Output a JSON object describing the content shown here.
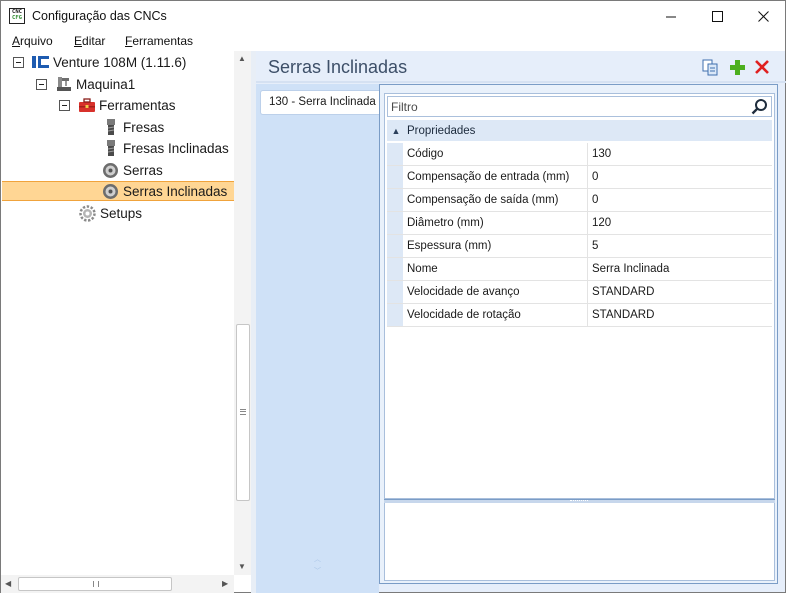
{
  "window": {
    "title": "Configuração das CNCs",
    "app_icon_text_top": "CNC",
    "app_icon_text_bottom": "CFG"
  },
  "menu": [
    {
      "underline": "A",
      "rest": "rquivo"
    },
    {
      "underline": "E",
      "rest": "ditar"
    },
    {
      "underline": "F",
      "rest": "erramentas"
    }
  ],
  "tree": {
    "root": "Venture 108M (1.11.6)",
    "machine": "Maquina1",
    "tools": "Ferramentas",
    "fresas": "Fresas",
    "fresas_inclinadas": "Fresas Inclinadas",
    "serras": "Serras",
    "serras_inclinadas": "Serras Inclinadas",
    "setups": "Setups"
  },
  "right": {
    "section_title": "Serras Inclinadas",
    "list_items": [
      "130 - Serra Inclinada"
    ]
  },
  "filter": {
    "placeholder": "Filtro"
  },
  "properties": {
    "category": "Propriedades",
    "rows": [
      {
        "name": "Código",
        "value": "130"
      },
      {
        "name": "Compensação de entrada (mm)",
        "value": "0"
      },
      {
        "name": "Compensação de saída (mm)",
        "value": "0"
      },
      {
        "name": "Diâmetro (mm)",
        "value": "120"
      },
      {
        "name": "Espessura (mm)",
        "value": "5"
      },
      {
        "name": "Nome",
        "value": "Serra Inclinada"
      },
      {
        "name": "Velocidade de avanço",
        "value": "STANDARD"
      },
      {
        "name": "Velocidade de rotação",
        "value": "STANDARD"
      }
    ]
  },
  "colors": {
    "accent_add": "#4caf1e",
    "accent_delete": "#e02020",
    "selected_bg": "#ffd694",
    "panel_bg": "#cfe1f7"
  }
}
